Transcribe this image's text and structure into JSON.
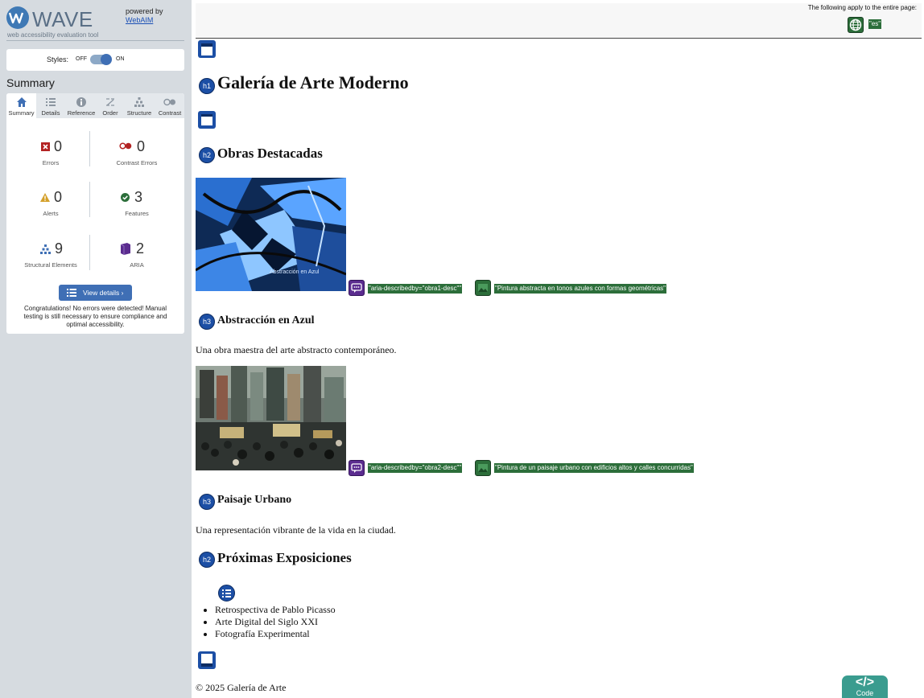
{
  "wave": {
    "logo_text": "WAVE",
    "tagline": "web accessibility evaluation tool",
    "powered_by": "powered by",
    "powered_link": "WebAIM",
    "styles_label": "Styles:",
    "toggle_off": "OFF",
    "toggle_on": "ON",
    "summary_heading": "Summary",
    "tabs": [
      {
        "label": "Summary",
        "icon": "home-icon",
        "active": true
      },
      {
        "label": "Details",
        "icon": "list-icon",
        "active": false
      },
      {
        "label": "Reference",
        "icon": "info-icon",
        "active": false
      },
      {
        "label": "Order",
        "icon": "order-icon",
        "active": false
      },
      {
        "label": "Structure",
        "icon": "structure-icon",
        "active": false
      },
      {
        "label": "Contrast",
        "icon": "contrast-icon",
        "active": false
      }
    ],
    "stats": {
      "errors": {
        "value": "0",
        "label": "Errors"
      },
      "contrast_errors": {
        "value": "0",
        "label": "Contrast Errors"
      },
      "alerts": {
        "value": "0",
        "label": "Alerts"
      },
      "features": {
        "value": "3",
        "label": "Features"
      },
      "structural": {
        "value": "9",
        "label": "Structural Elements"
      },
      "aria": {
        "value": "2",
        "label": "ARIA"
      }
    },
    "view_details": "View details ›",
    "congrats": "Congratulations! No errors were detected! Manual testing is still necessary to ensure compliance and optimal accessibility."
  },
  "page": {
    "top_note": "The following apply to the entire page:",
    "lang_tag": "\"es\"",
    "h1": "Galería de Arte Moderno",
    "section_featured": "Obras Destacadas",
    "art1": {
      "aria_tag": "\"aria-describedby=\"obra1-desc\"\"",
      "alt_tag": "\"Pintura abstracta en tonos azules con formas geométricas\"",
      "title": "Abstracción en Azul",
      "desc": "Una obra maestra del arte abstracto contemporáneo.",
      "caption": "Abstracción en Azul"
    },
    "art2": {
      "aria_tag": "\"aria-describedby=\"obra2-desc\"\"",
      "alt_tag": "\"Pintura de un paisaje urbano con edificios altos y calles concurridas\"",
      "title": "Paisaje Urbano",
      "desc": "Una representación vibrante de la vida en la ciudad."
    },
    "section_upcoming": "Próximas Exposiciones",
    "exhibitions": [
      "Retrospectiva de Pablo Picasso",
      "Arte Digital del Siglo XXI",
      "Fotografía Experimental"
    ],
    "footer": "© 2025 Galería de Arte",
    "code_button": "Code",
    "badges": {
      "h1": "h1",
      "h2": "h2",
      "h3": "h3"
    }
  },
  "colors": {
    "wave_blue": "#3f6fb5",
    "feature_green": "#2c6e3a",
    "aria_purple": "#5b2c8f",
    "heading_blue": "#1c4fa5",
    "sidebar_bg": "#d6dbe0"
  }
}
